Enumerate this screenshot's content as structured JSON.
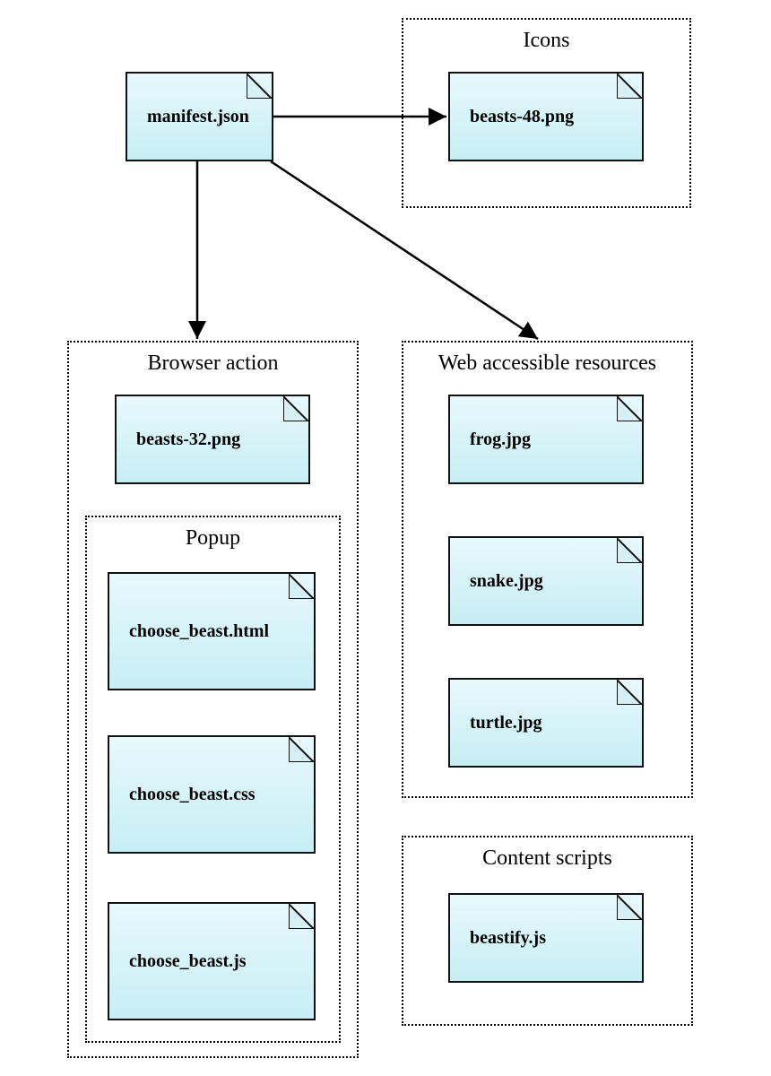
{
  "files": {
    "manifest": "manifest.json",
    "icons": {
      "label": "Icons",
      "file": "beasts-48.png"
    },
    "browser_action": {
      "label": "Browser action",
      "file": "beasts-32.png",
      "popup": {
        "label": "Popup",
        "files": [
          "choose_beast.html",
          "choose_beast.css",
          "choose_beast.js"
        ]
      }
    },
    "war": {
      "label": "Web accessible resources",
      "files": [
        "frog.jpg",
        "snake.jpg",
        "turtle.jpg"
      ]
    },
    "content_scripts": {
      "label": "Content scripts",
      "file": "beastify.js"
    }
  }
}
